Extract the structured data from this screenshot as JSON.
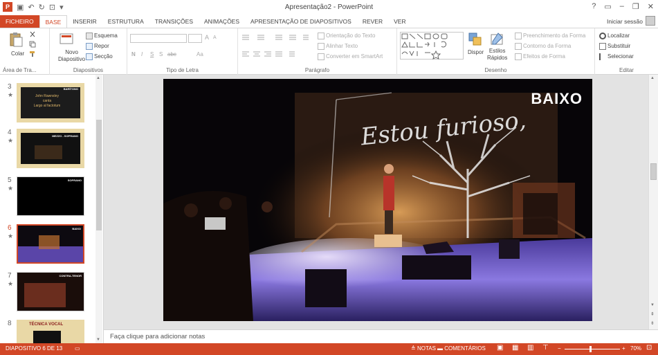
{
  "window": {
    "title": "Apresentação2 - PowerPoint",
    "help": "?",
    "controls": [
      "▭",
      "–",
      "❐",
      "✕"
    ]
  },
  "qat": {
    "logo": "P",
    "save": "▣",
    "undo": "↶",
    "redo": "↻",
    "present": "⊡",
    "more": "▾"
  },
  "tabs": [
    "FICHEIRO",
    "BASE",
    "INSERIR",
    "ESTRUTURA",
    "TRANSIÇÕES",
    "ANIMAÇÕES",
    "APRESENTAÇÃO DE DIAPOSITIVOS",
    "REVER",
    "VER"
  ],
  "active_tab": "BASE",
  "signin": "Iniciar sessão",
  "ribbon": {
    "clipboard": {
      "label": "Área de Tra...",
      "paste": "Colar"
    },
    "slides": {
      "label": "Diapositivos",
      "new_slide": [
        "Novo",
        "Diapositivo"
      ],
      "layout": "Esquema",
      "reset": "Repor",
      "section": "Secção"
    },
    "font": {
      "label": "Tipo de Letra",
      "bold": "N",
      "italic": "I",
      "underline": "S",
      "shadow": "S",
      "strike": "abc",
      "aa": "Aa",
      "grow": "A",
      "shrink": "A"
    },
    "paragraph": {
      "label": "Parágrafo",
      "direction": "Orientação do Texto",
      "align": "Alinhar Texto",
      "smartart": "Converter em SmartArt"
    },
    "drawing": {
      "label": "Desenho",
      "arrange": "Dispor",
      "styles": [
        "Estilos",
        "Rápidos"
      ],
      "fill": "Preenchimento da Forma",
      "outline": "Contorno da Forma",
      "effects": "Efeitos de Forma"
    },
    "editing": {
      "label": "Editar",
      "find": "Localizar",
      "replace": "Substituir",
      "select": "Selecionar"
    }
  },
  "thumbnails": [
    {
      "num": "3",
      "tag": "BARÍTONO",
      "lines": [
        "John Rawnsley",
        "canta",
        "Largo al factotum"
      ]
    },
    {
      "num": "4",
      "tag": "MEZZO - SOPRANO",
      "lines": []
    },
    {
      "num": "5",
      "tag": "SOPRANO",
      "lines": []
    },
    {
      "num": "6",
      "tag": "BAIXO",
      "lines": []
    },
    {
      "num": "7",
      "tag": "CONTRA-TENOR",
      "lines": []
    },
    {
      "num": "8",
      "tag": "TÉCNICA VOCAL",
      "lines": []
    }
  ],
  "slide": {
    "title": "BAIXO",
    "projected_text": "Estou furioso,"
  },
  "notes_placeholder": "Faça clique para adicionar notas",
  "status": {
    "slide_info": "DIAPOSITIVO 6 DE 13",
    "notes": "NOTAS",
    "comments": "COMENTÁRIOS",
    "zoom": "70%"
  },
  "colors": {
    "accent": "#d24726",
    "stage_purple": "#7a5fd6"
  }
}
